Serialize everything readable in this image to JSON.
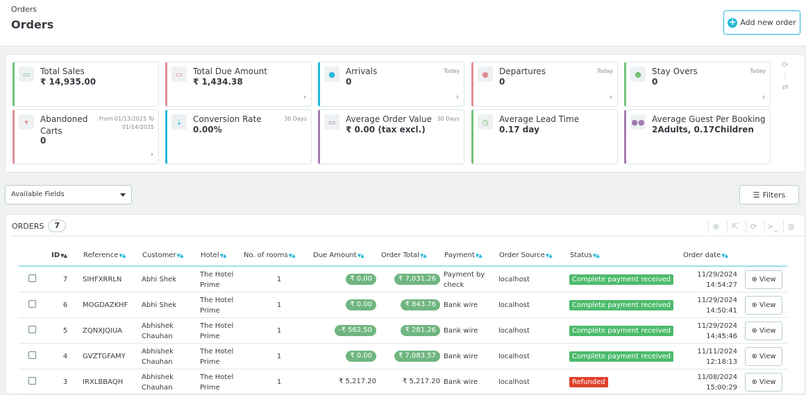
{
  "header": {
    "breadcrumb": "Orders",
    "title": "Orders",
    "add_order_label": "Add new order"
  },
  "kpis": [
    {
      "title": "Total Sales",
      "value": "₹ 14,935.00",
      "subtitle": "",
      "icon": "money-icon",
      "color": "#72c279"
    },
    {
      "title": "Total Due Amount",
      "value": "₹ 1,434.38",
      "subtitle": "",
      "icon": "money-icon",
      "color": "#e08f95"
    },
    {
      "title": "Arrivals",
      "value": "0",
      "subtitle": "Today",
      "icon": "user-icon",
      "color": "#25b9d7"
    },
    {
      "title": "Departures",
      "value": "0",
      "subtitle": "Today",
      "icon": "user-icon",
      "color": "#e08f95"
    },
    {
      "title": "Stay Overs",
      "value": "0",
      "subtitle": "Today",
      "icon": "user-icon",
      "color": "#72c279"
    },
    {
      "title": "Abandoned Carts",
      "value": "0",
      "subtitle": "From 01/13/2025 To 01/14/2025",
      "icon": "cart-icon",
      "color": "#e08f95"
    },
    {
      "title": "Conversion Rate",
      "value": "0.00%",
      "subtitle": "30 Days",
      "icon": "sort-icon",
      "color": "#25b9d7"
    },
    {
      "title": "Average Order Value",
      "value": "₹ 0.00 (tax excl.)",
      "subtitle": "30 Days",
      "icon": "money-icon",
      "color": "#a27cb0"
    },
    {
      "title": "Average Lead Time",
      "value": "0.17 day",
      "subtitle": "",
      "icon": "clock-icon",
      "color": "#72c279"
    },
    {
      "title": "Average Guest Per Booking",
      "value": "2Adults, 0.17Children",
      "subtitle": "",
      "icon": "users-icon",
      "color": "#a27cb0"
    }
  ],
  "toolbar": {
    "available_fields": "Available Fields",
    "filters_label": "Filters"
  },
  "orders": {
    "heading": "ORDERS",
    "count": "7",
    "columns": [
      "ID",
      "Reference",
      "Customer",
      "Hotel",
      "No. of rooms",
      "Due Amount",
      "Order Total",
      "Payment",
      "Order Source",
      "Status",
      "Order date"
    ],
    "view_label": "View",
    "rows": [
      {
        "id": "7",
        "reference": "SIHFXRRLN",
        "customer": "Abhi Shek",
        "hotel": "The Hotel Prime",
        "rooms": "1",
        "due": "₹ 0.00",
        "due_pill": true,
        "total": "₹ 7,031.26",
        "total_pill": true,
        "payment": "Payment by check",
        "source": "localhost",
        "status": "Complete payment received",
        "status_color": "#4cbb6c",
        "date": "11/29/2024",
        "time": "14:54:27"
      },
      {
        "id": "6",
        "reference": "MOGDAZKHF",
        "customer": "Abhi Shek",
        "hotel": "The Hotel Prime",
        "rooms": "1",
        "due": "₹ 0.00",
        "due_pill": true,
        "total": "₹ 843.76",
        "total_pill": true,
        "payment": "Bank wire",
        "source": "localhost",
        "status": "Complete payment received",
        "status_color": "#4cbb6c",
        "date": "11/29/2024",
        "time": "14:50:41"
      },
      {
        "id": "5",
        "reference": "ZQNXJQIUA",
        "customer": "Abhishek Chauhan",
        "hotel": "The Hotel Prime",
        "rooms": "1",
        "due": "-₹ 562.50",
        "due_pill": true,
        "total": "₹ 281.26",
        "total_pill": true,
        "payment": "Bank wire",
        "source": "localhost",
        "status": "Complete payment received",
        "status_color": "#4cbb6c",
        "date": "11/29/2024",
        "time": "14:45:46"
      },
      {
        "id": "4",
        "reference": "GVZTGFAMY",
        "customer": "Abhishek Chauhan",
        "hotel": "The Hotel Prime",
        "rooms": "1",
        "due": "₹ 0.00",
        "due_pill": true,
        "total": "₹ 7,083.57",
        "total_pill": true,
        "payment": "Bank wire",
        "source": "localhost",
        "status": "Complete payment received",
        "status_color": "#4cbb6c",
        "date": "11/11/2024",
        "time": "12:18:13"
      },
      {
        "id": "3",
        "reference": "IRXLBBAQH",
        "customer": "Abhishek Chauhan",
        "hotel": "The Hotel Prime",
        "rooms": "1",
        "due": "₹ 5,217.20",
        "due_pill": false,
        "total": "₹ 5,217.20",
        "total_pill": false,
        "payment": "Bank wire",
        "source": "localhost",
        "status": "Refunded",
        "status_color": "#e0412d",
        "date": "11/08/2024",
        "time": "15:00:29"
      }
    ]
  }
}
